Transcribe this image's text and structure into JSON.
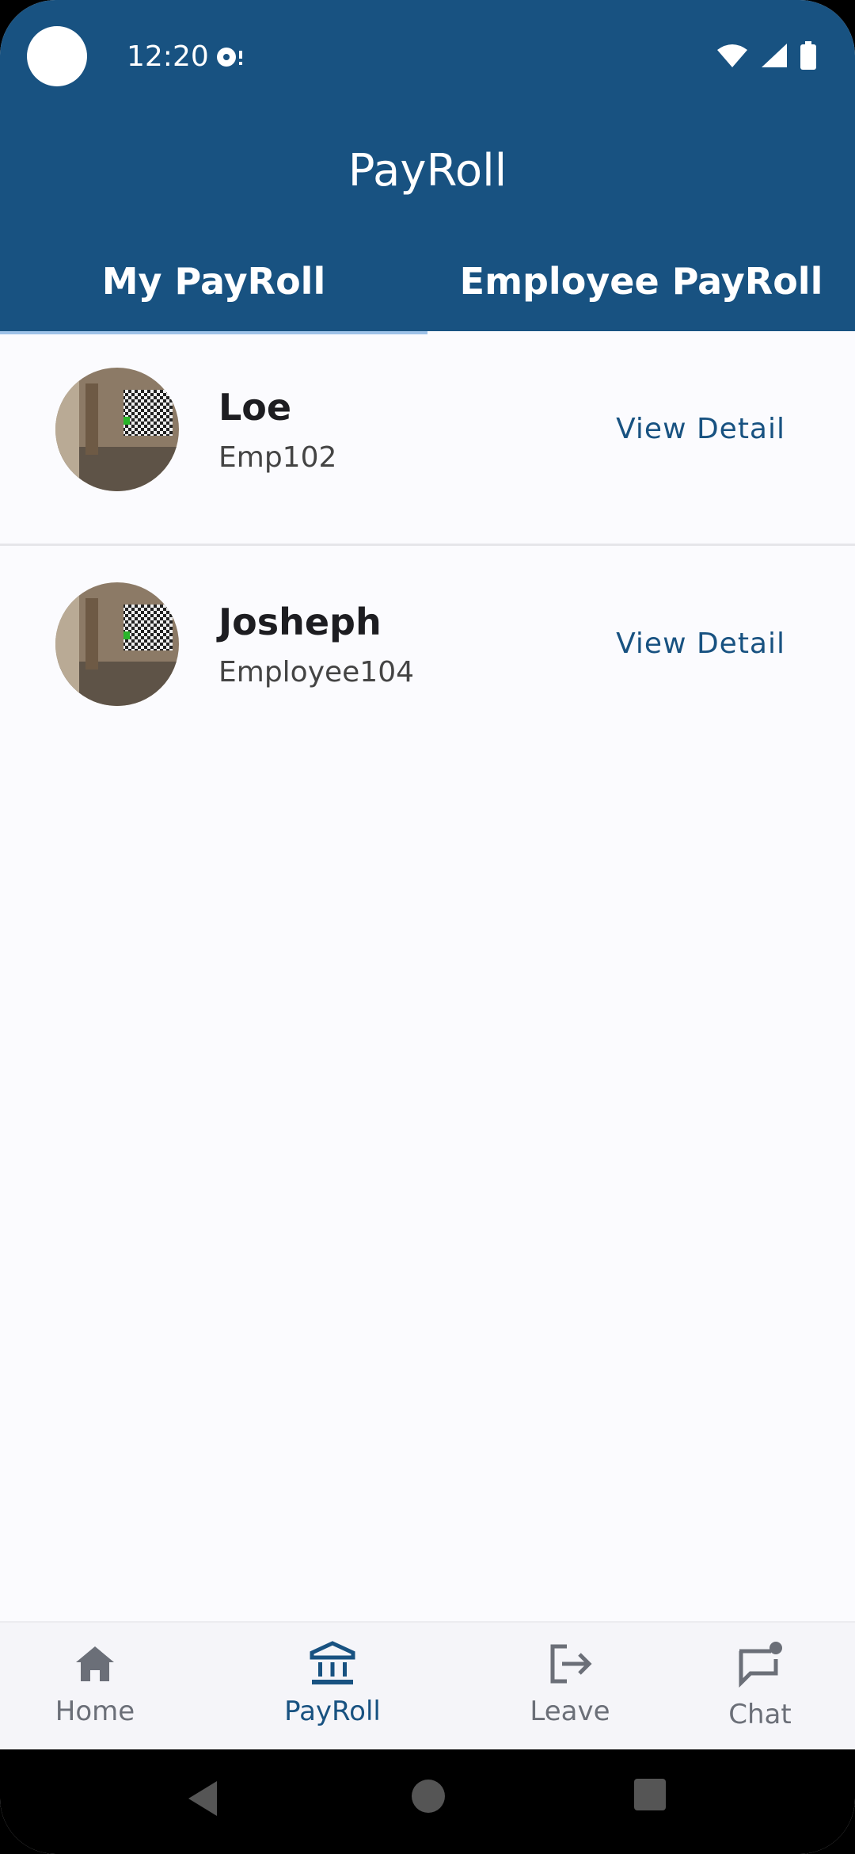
{
  "status_bar": {
    "time": "12:20",
    "icons": [
      "notification-icon",
      "wifi-icon",
      "signal-icon",
      "battery-icon"
    ]
  },
  "app_bar": {
    "title": "PayRoll"
  },
  "tabs": [
    {
      "label": "My PayRoll",
      "selected": true
    },
    {
      "label": "Employee PayRoll",
      "selected": false
    }
  ],
  "employees": [
    {
      "name": "Loe",
      "id": "Emp102",
      "action": "View Detail"
    },
    {
      "name": "Josheph",
      "id": "Employee104",
      "action": "View Detail"
    }
  ],
  "bottom_nav": [
    {
      "label": "Home",
      "icon": "home-icon",
      "active": false
    },
    {
      "label": "PayRoll",
      "icon": "bank-icon",
      "active": true
    },
    {
      "label": "Leave",
      "icon": "logout-icon",
      "active": false
    },
    {
      "label": "Chat",
      "icon": "chat-icon",
      "active": false
    }
  ],
  "colors": {
    "primary": "#185281",
    "background": "#fbfbfe",
    "inactive_nav": "#6b6f78"
  }
}
